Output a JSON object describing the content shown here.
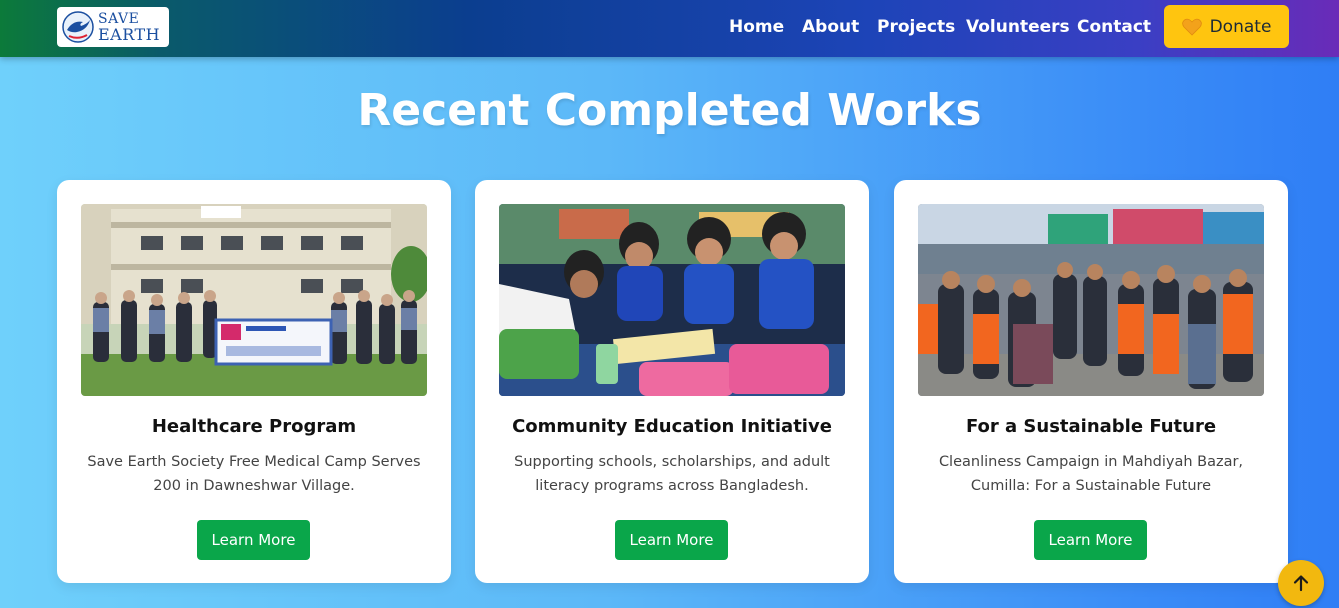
{
  "brand": {
    "logo_line1": "SAVE",
    "logo_line2": "EARTH"
  },
  "nav": {
    "items": [
      "Home",
      "About",
      "Projects",
      "Volunteers",
      "Contact"
    ],
    "donate_label": "Donate"
  },
  "section": {
    "title": "Recent Completed Works"
  },
  "cards": [
    {
      "title": "Healthcare Program",
      "description": "Save Earth Society Free Medical Camp Serves 200 in Dawneshwar Village.",
      "button": "Learn More"
    },
    {
      "title": "Community Education Initiative",
      "description": "Supporting schools, scholarships, and adult literacy programs across Bangladesh.",
      "button": "Learn More"
    },
    {
      "title": "For a Sustainable Future",
      "description": "Cleanliness Campaign in Mahdiyah Bazar, Cumilla: For a Sustainable Future",
      "button": "Learn More"
    }
  ],
  "icons": {
    "logo": "dove-globe-icon",
    "donate": "heart-icon",
    "scroll_top": "arrow-up-icon"
  },
  "colors": {
    "donate_bg": "#ffc50f",
    "learn_more_bg": "#0aa64a",
    "scroll_top_bg": "#f2b80f"
  }
}
